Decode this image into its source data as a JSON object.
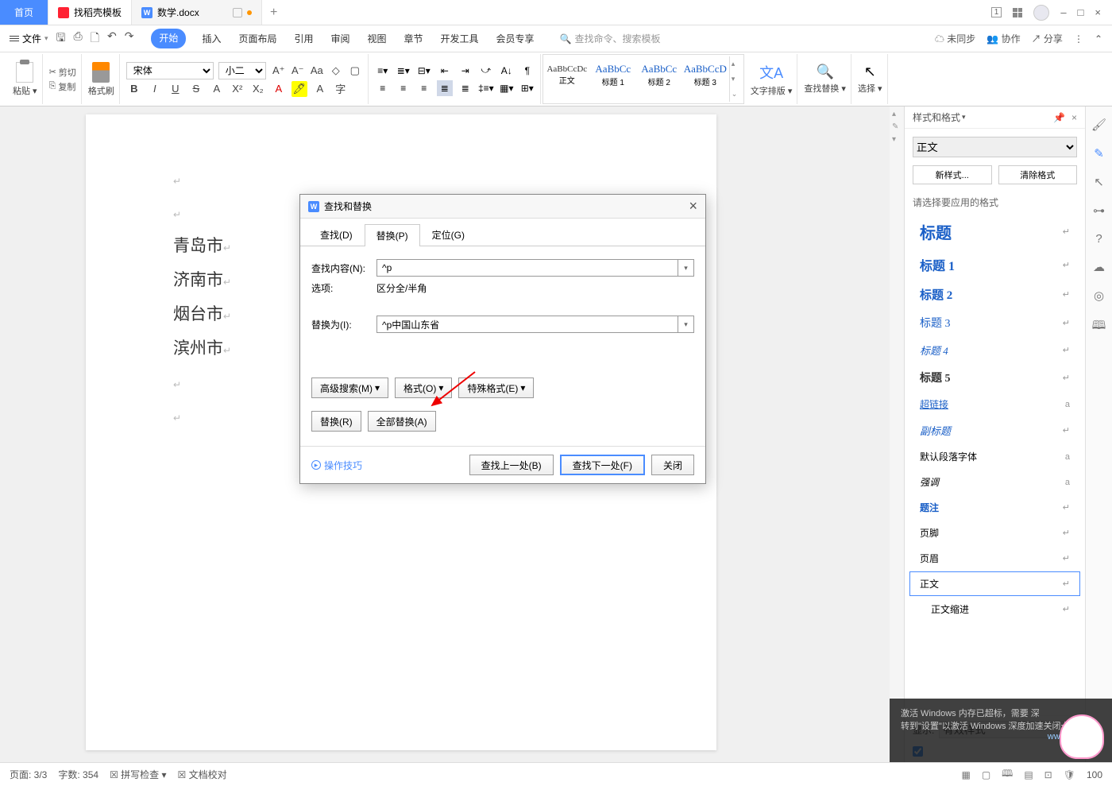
{
  "titlebar": {
    "tabs": {
      "home": "首页",
      "templates": "找稻壳模板",
      "doc": "数学.docx"
    },
    "win": {
      "num": "1",
      "minimize": "–",
      "maximize": "□",
      "close": "×"
    }
  },
  "menubar": {
    "file": "文件",
    "menus": [
      "开始",
      "插入",
      "页面布局",
      "引用",
      "审阅",
      "视图",
      "章节",
      "开发工具",
      "会员专享"
    ],
    "search_placeholder": "查找命令、搜索模板",
    "right": {
      "sync": "未同步",
      "collab": "协作",
      "share": "分享"
    }
  },
  "ribbon": {
    "paste": "粘贴",
    "cut": "剪切",
    "copy": "复制",
    "painter": "格式刷",
    "font": "宋体",
    "size": "小二",
    "styles_body": "正文",
    "styles_body_pv": "AaBbCcDc",
    "styles": [
      {
        "pv": "AaBbCc",
        "name": "标题 1"
      },
      {
        "pv": "AaBbCc",
        "name": "标题 2"
      },
      {
        "pv": "AaBbCcD",
        "name": "标题 3"
      }
    ],
    "textdirection": "文字排版",
    "findreplace": "查找替换",
    "select": "选择"
  },
  "document": {
    "lines": [
      "青岛市",
      "济南市",
      "烟台市",
      "滨州市"
    ]
  },
  "dialog": {
    "title": "查找和替换",
    "tabs": {
      "find": "查找(D)",
      "replace": "替换(P)",
      "goto": "定位(G)"
    },
    "find_label": "查找内容(N):",
    "find_value": "^p",
    "options_label": "选项:",
    "options_text": "区分全/半角",
    "replace_label": "替换为(I):",
    "replace_value": "^p中国山东省",
    "advsearch": "高级搜索(M)",
    "format": "格式(O)",
    "special": "特殊格式(E)",
    "replace_one": "替换(R)",
    "replace_all": "全部替换(A)",
    "tips": "操作技巧",
    "find_prev": "查找上一处(B)",
    "find_next": "查找下一处(F)",
    "close": "关闭"
  },
  "stylepanel": {
    "title": "样式和格式",
    "current": "正文",
    "newstyle": "新样式...",
    "clearfmt": "清除格式",
    "hint": "请选择要应用的格式",
    "items": [
      {
        "t": "标题",
        "cls": "h0",
        "m": "↵"
      },
      {
        "t": "标题 1",
        "cls": "h1s",
        "m": "↵"
      },
      {
        "t": "标题 2",
        "cls": "h2s",
        "m": "↵"
      },
      {
        "t": "标题 3",
        "cls": "h3s",
        "m": "↵"
      },
      {
        "t": "标题 4",
        "cls": "h4s",
        "m": "↵"
      },
      {
        "t": "标题 5",
        "cls": "h5s",
        "m": "↵"
      },
      {
        "t": "超链接",
        "cls": "hlink",
        "m": "a"
      },
      {
        "t": "副标题",
        "cls": "subt",
        "m": "↵"
      },
      {
        "t": "默认段落字体",
        "cls": "",
        "m": "a"
      },
      {
        "t": "强调",
        "cls": "emph",
        "m": "a"
      },
      {
        "t": "题注",
        "cls": "footn",
        "m": "↵"
      },
      {
        "t": "页脚",
        "cls": "",
        "m": "↵"
      },
      {
        "t": "页眉",
        "cls": "",
        "m": "↵"
      },
      {
        "t": "正文",
        "cls": "",
        "m": "↵",
        "sel": true
      },
      {
        "t": "正文缩进",
        "cls": "",
        "m": "↵",
        "indent": true
      }
    ],
    "show_label": "显示:",
    "show_value": "有效样式"
  },
  "statusbar": {
    "page": "页面: 3/3",
    "words": "字数: 354",
    "spell": "拼写检查",
    "proof": "文档校对",
    "zoom": "100"
  },
  "overlay": {
    "l1": "激活 Windows   内存已超标，需要 深",
    "l2": "转到\"设置\"以激活 Windows 深度加速关闭卡慢进",
    "l3": "www.xz7.com"
  }
}
